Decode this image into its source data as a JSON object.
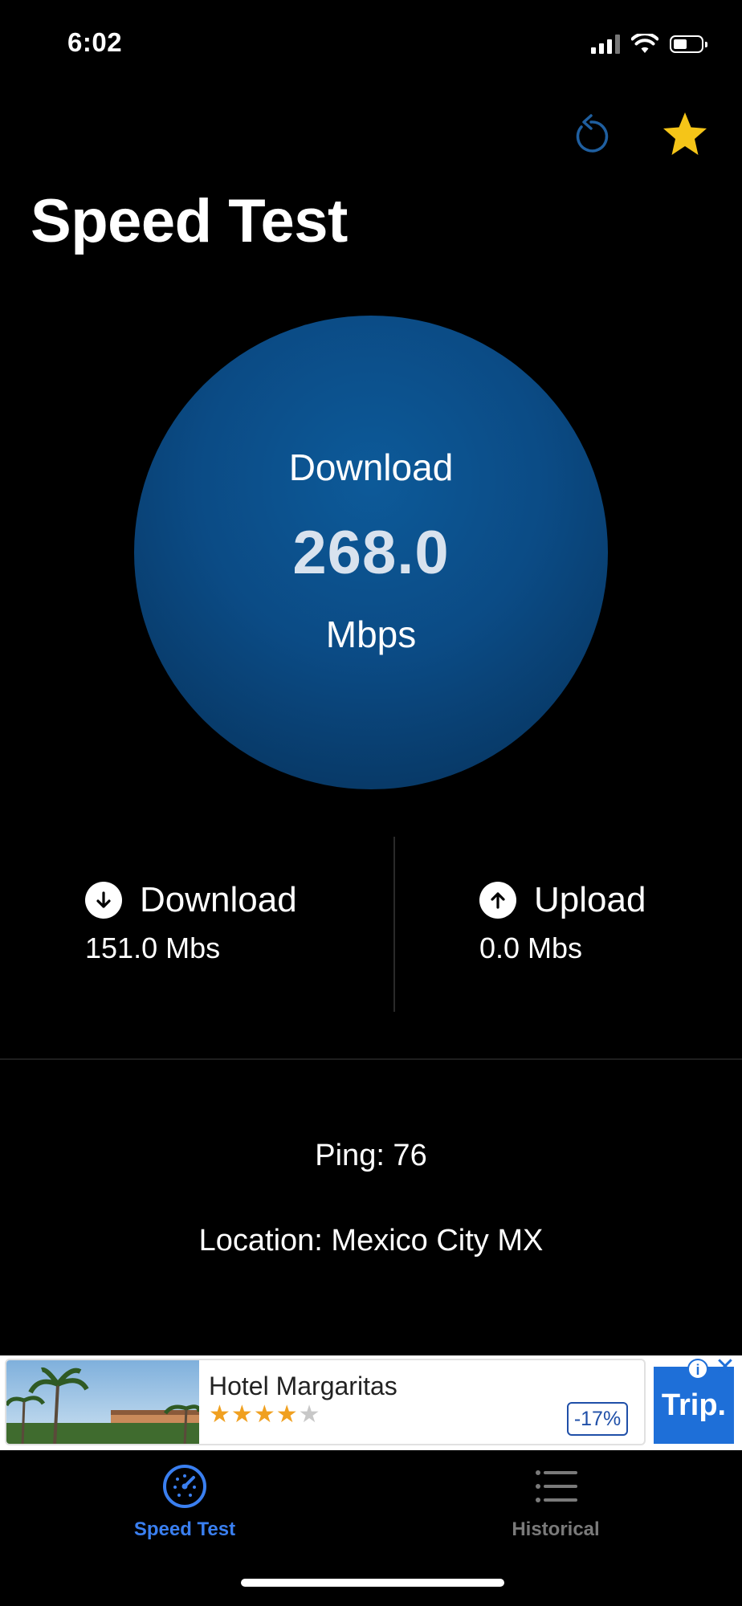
{
  "status_bar": {
    "time": "6:02"
  },
  "header": {
    "title": "Speed Test"
  },
  "gauge": {
    "label": "Download",
    "value": "268.0",
    "unit": "Mbps"
  },
  "stats": {
    "download": {
      "label": "Download",
      "value": "151.0 Mbs"
    },
    "upload": {
      "label": "Upload",
      "value": "0.0 Mbs"
    }
  },
  "details": {
    "ping": "Ping: 76",
    "location": "Location: Mexico City MX"
  },
  "ad": {
    "title": "Hotel Margaritas",
    "rating_stars": 4,
    "rating_max": 5,
    "discount": "-17%",
    "logo": "Trip."
  },
  "tabs": [
    {
      "label": "Speed Test",
      "icon": "speedometer-icon",
      "active": true
    },
    {
      "label": "Historical",
      "icon": "list-icon",
      "active": false
    }
  ],
  "colors": {
    "accent": "#3a7ff0",
    "star": "#f5c518",
    "gauge": "#0b4b85",
    "background": "#000000"
  }
}
